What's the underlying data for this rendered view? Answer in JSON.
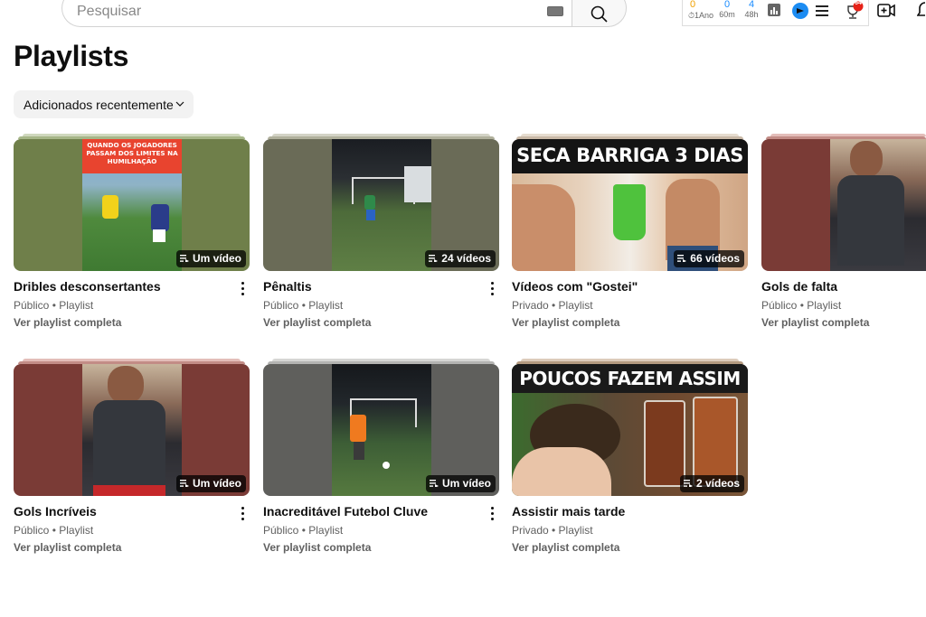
{
  "search": {
    "placeholder": "Pesquisar"
  },
  "extension": {
    "counters": [
      {
        "value": "0",
        "label": "1Ano",
        "color": "#f0a000"
      },
      {
        "value": "0",
        "label": "60m",
        "color": "#1a8cff"
      },
      {
        "value": "4",
        "label": "48h",
        "color": "#1a8cff"
      }
    ],
    "trophy_badge": "64"
  },
  "page": {
    "title": "Playlists"
  },
  "sort": {
    "label": "Adicionados recentemente"
  },
  "playlists": [
    {
      "title": "Dribles desconsertantes",
      "meta": "Público • Playlist",
      "link": "Ver playlist completa",
      "count": "Um vídeo",
      "overlay": "QUANDO OS JOGADORES PASSAM DOS LIMITES NA HUMILHAÇÃO",
      "bg": "#6f7f4a",
      "stack": "#a6b688"
    },
    {
      "title": "Pênaltis",
      "meta": "Público • Playlist",
      "link": "Ver playlist completa",
      "count": "24 vídeos",
      "bg": "#6a6b57",
      "stack": "#b0b09c"
    },
    {
      "title": "Vídeos com \"Gostei\"",
      "meta": "Privado • Playlist",
      "link": "Ver playlist completa",
      "count": "66 vídeos",
      "overlay": "SECA BARRIGA 3 DIAS",
      "bg": "#e9dfd6",
      "stack": "#c9b9a7"
    },
    {
      "title": "Gols de falta",
      "meta": "Público • Playlist",
      "link": "Ver playlist completa",
      "count": "",
      "bg": "#7a3b36",
      "stack": "#c28c86"
    },
    {
      "title": "Gols Incríveis",
      "meta": "Público • Playlist",
      "link": "Ver playlist completa",
      "count": "Um vídeo",
      "bg": "#7a3b36",
      "stack": "#c28c86"
    },
    {
      "title": "Inacreditável Futebol Cluve",
      "meta": "Público • Playlist",
      "link": "Ver playlist completa",
      "count": "Um vídeo",
      "bg": "#5f5f5c",
      "stack": "#b3b3b1"
    },
    {
      "title": "Assistir mais tarde",
      "meta": "Privado • Playlist",
      "link": "Ver playlist completa",
      "count": "2 vídeos",
      "overlay": "POUCOS FAZEM ASSIM",
      "bg": "#4a3a2a",
      "stack": "#b49a80"
    }
  ]
}
